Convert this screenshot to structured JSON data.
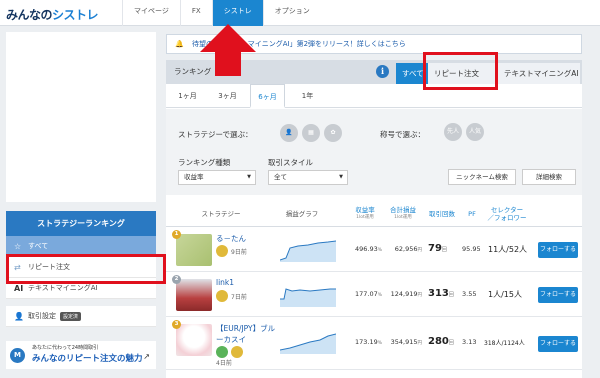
{
  "header": {
    "logo_main": "みんなの",
    "logo_accent": "シストレ",
    "nav": [
      "マイページ",
      "FX",
      "シストレ",
      "オプション"
    ]
  },
  "sidebar": {
    "title": "ストラテジーランキング",
    "items": [
      "すべて",
      "リピート注文",
      "テキストマイニングAI"
    ],
    "settings_label": "取引設定",
    "settings_badge": "設定済",
    "banner_small": "あなたに代わって24時間取引",
    "banner_main": "みんなのリピート注文の魅力",
    "banner_icon": "M"
  },
  "notice": {
    "text": "待望の「テキストマイニングAI」第2弾をリリース！詳しくはこちら"
  },
  "ranking": {
    "title": "ランキング",
    "info_symbol": "i",
    "tabs": [
      "すべて",
      "リピート注文",
      "テキストマイニングAI"
    ],
    "periods": [
      "1ヶ月",
      "3ヶ月",
      "6ヶ月",
      "1年"
    ],
    "active_period": "6ヶ月",
    "filter": {
      "strategy_label": "ストラテジーで選ぶ：",
      "title_label": "称号で選ぶ：",
      "title_badges": [
        "先人",
        "人気"
      ],
      "type_label": "ランキング種類",
      "type_value": "収益率",
      "style_label": "取引スタイル",
      "style_value": "全て",
      "nickname_button": "ニックネーム検索",
      "detail_button": "詳細検索"
    },
    "columns": {
      "strategy": "ストラテジー",
      "graph": "損益グラフ",
      "return_rate": "収益率",
      "return_rate_sub": "1lot運用",
      "total_pl": "合計損益",
      "total_pl_sub": "1lot運用",
      "trades": "取引回数",
      "pf": "PF",
      "selector": "セレクター",
      "selector_sub": "／フォロワー"
    },
    "follow_label": "フォローする",
    "rows": [
      {
        "rank": "1",
        "name": "る－たん",
        "age": "9日前",
        "return_rate": "496.93",
        "return_unit": "%",
        "total_pl": "62,956",
        "pl_unit": "円",
        "trades": "79",
        "trades_unit": "回",
        "pf": "95.95",
        "selector": "11人/52人"
      },
      {
        "rank": "2",
        "name": "link1",
        "age": "7日前",
        "return_rate": "177.07",
        "return_unit": "%",
        "total_pl": "124,919",
        "pl_unit": "円",
        "trades": "313",
        "trades_unit": "回",
        "pf": "3.55",
        "selector": "1人/15人"
      },
      {
        "rank": "3",
        "name": "【EUR/JPY】ブル",
        "name2": "ーカスイ",
        "age": "4日前",
        "return_rate": "173.19",
        "return_unit": "%",
        "total_pl": "354,915",
        "pl_unit": "円",
        "trades": "280",
        "trades_unit": "回",
        "pf": "3.13",
        "selector": "318人/1124人"
      }
    ]
  },
  "colors": {
    "brand_blue": "#1b86d0",
    "annotation_red": "#e0101d"
  }
}
